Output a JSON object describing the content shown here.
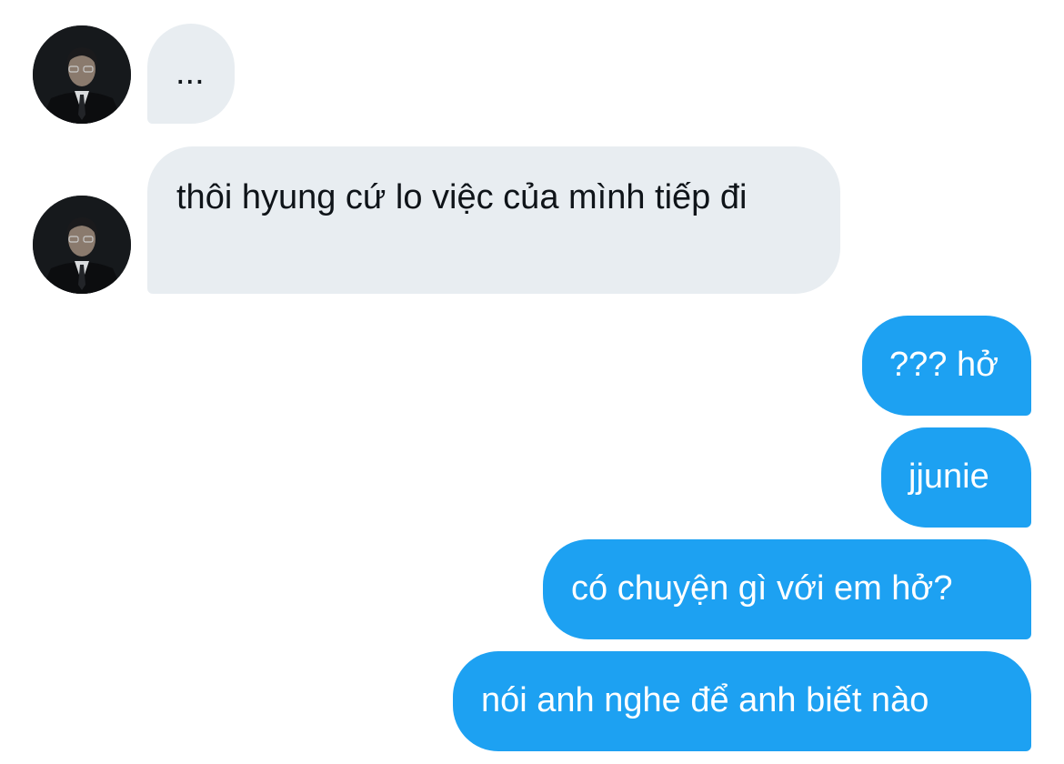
{
  "conversation": {
    "incoming": [
      {
        "avatar_icon": "user-photo-avatar",
        "text": "..."
      },
      {
        "avatar_icon": "user-photo-avatar",
        "text": "thôi hyung cứ lo việc của mình tiếp đi"
      }
    ],
    "outgoing": [
      {
        "text": "??? hở"
      },
      {
        "text": "jjunie"
      },
      {
        "text": "có chuyện gì với em hở?"
      },
      {
        "text": "nói anh nghe để anh biết nào"
      }
    ]
  },
  "colors": {
    "incoming_bubble": "#e8edf1",
    "incoming_text": "#0f1419",
    "outgoing_bubble": "#1da1f2",
    "outgoing_text": "#ffffff",
    "background": "#ffffff"
  }
}
